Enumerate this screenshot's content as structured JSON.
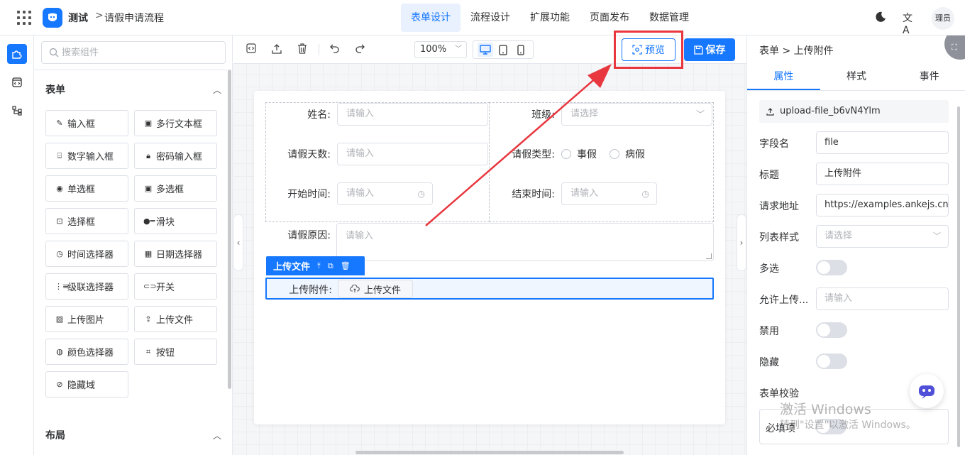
{
  "header": {
    "app_name": "测试",
    "breadcrumb_sep": ">",
    "page_name": "请假申请流程",
    "tabs": [
      {
        "label": "表单设计",
        "active": true
      },
      {
        "label": "流程设计",
        "active": false
      },
      {
        "label": "扩展功能",
        "active": false
      },
      {
        "label": "页面发布",
        "active": false
      },
      {
        "label": "数据管理",
        "active": false
      }
    ],
    "translate_glyph": "文A",
    "user_label": "理员",
    "accent_color": "#1677ff"
  },
  "palette": {
    "search_placeholder": "搜索组件",
    "groups": [
      {
        "title": "表单",
        "items": [
          {
            "label": "输入框",
            "icon": "edit-icon"
          },
          {
            "label": "多行文本框",
            "icon": "textarea-icon"
          },
          {
            "label": "数字输入框",
            "icon": "number-icon"
          },
          {
            "label": "密码输入框",
            "icon": "lock-icon"
          },
          {
            "label": "单选框",
            "icon": "radio-icon"
          },
          {
            "label": "多选框",
            "icon": "checkbox-icon"
          },
          {
            "label": "选择框",
            "icon": "select-icon"
          },
          {
            "label": "滑块",
            "icon": "slider-icon"
          },
          {
            "label": "时间选择器",
            "icon": "clock-icon"
          },
          {
            "label": "日期选择器",
            "icon": "calendar-icon"
          },
          {
            "label": "级联选择器",
            "icon": "cascader-icon"
          },
          {
            "label": "开关",
            "icon": "switch-icon"
          },
          {
            "label": "上传图片",
            "icon": "image-icon"
          },
          {
            "label": "上传文件",
            "icon": "upload-icon"
          },
          {
            "label": "颜色选择器",
            "icon": "palette-icon"
          },
          {
            "label": "按钮",
            "icon": "button-icon"
          },
          {
            "label": "隐藏域",
            "icon": "eye-off-icon"
          }
        ]
      },
      {
        "title": "布局"
      }
    ]
  },
  "toolbar": {
    "zoom": "100%",
    "preview_label": "预览",
    "save_label": "保存"
  },
  "form": {
    "fields": {
      "name": {
        "label": "姓名:",
        "placeholder": "请输入"
      },
      "class": {
        "label": "班级:",
        "placeholder": "请选择"
      },
      "days": {
        "label": "请假天数:",
        "placeholder": "请输入"
      },
      "type": {
        "label": "请假类型:",
        "options": [
          "事假",
          "病假"
        ]
      },
      "start": {
        "label": "开始时间:",
        "placeholder": "请输入"
      },
      "end": {
        "label": "结束时间:",
        "placeholder": "请输入"
      },
      "reason": {
        "label": "请假原因:",
        "placeholder": "请输入"
      },
      "attach": {
        "label": "上传附件:",
        "button": "上传文件"
      }
    },
    "selected_tag": "上传文件"
  },
  "props": {
    "breadcrumb_root": "表单",
    "breadcrumb_sep": ">",
    "breadcrumb_current": "上传附件",
    "tabs": [
      {
        "label": "属性",
        "active": true
      },
      {
        "label": "样式",
        "active": false
      },
      {
        "label": "事件",
        "active": false
      }
    ],
    "component_id": "upload-file_b6vN4Ylm",
    "field_name_label": "字段名",
    "field_name_value": "file",
    "title_label": "标题",
    "title_value": "上传附件",
    "url_label": "请求地址",
    "url_value": "https://examples.ankejs.cn/",
    "list_style_label": "列表样式",
    "list_style_placeholder": "请选择",
    "multiple_label": "多选",
    "allow_label": "允许上传...",
    "allow_placeholder": "请输入",
    "disabled_label": "禁用",
    "hidden_label": "隐藏",
    "validation_label": "表单校验",
    "required_label": "必填项"
  },
  "watermark": {
    "line1": "激活 Windows",
    "line2": "转到\"设置\"以激活 Windows。"
  }
}
